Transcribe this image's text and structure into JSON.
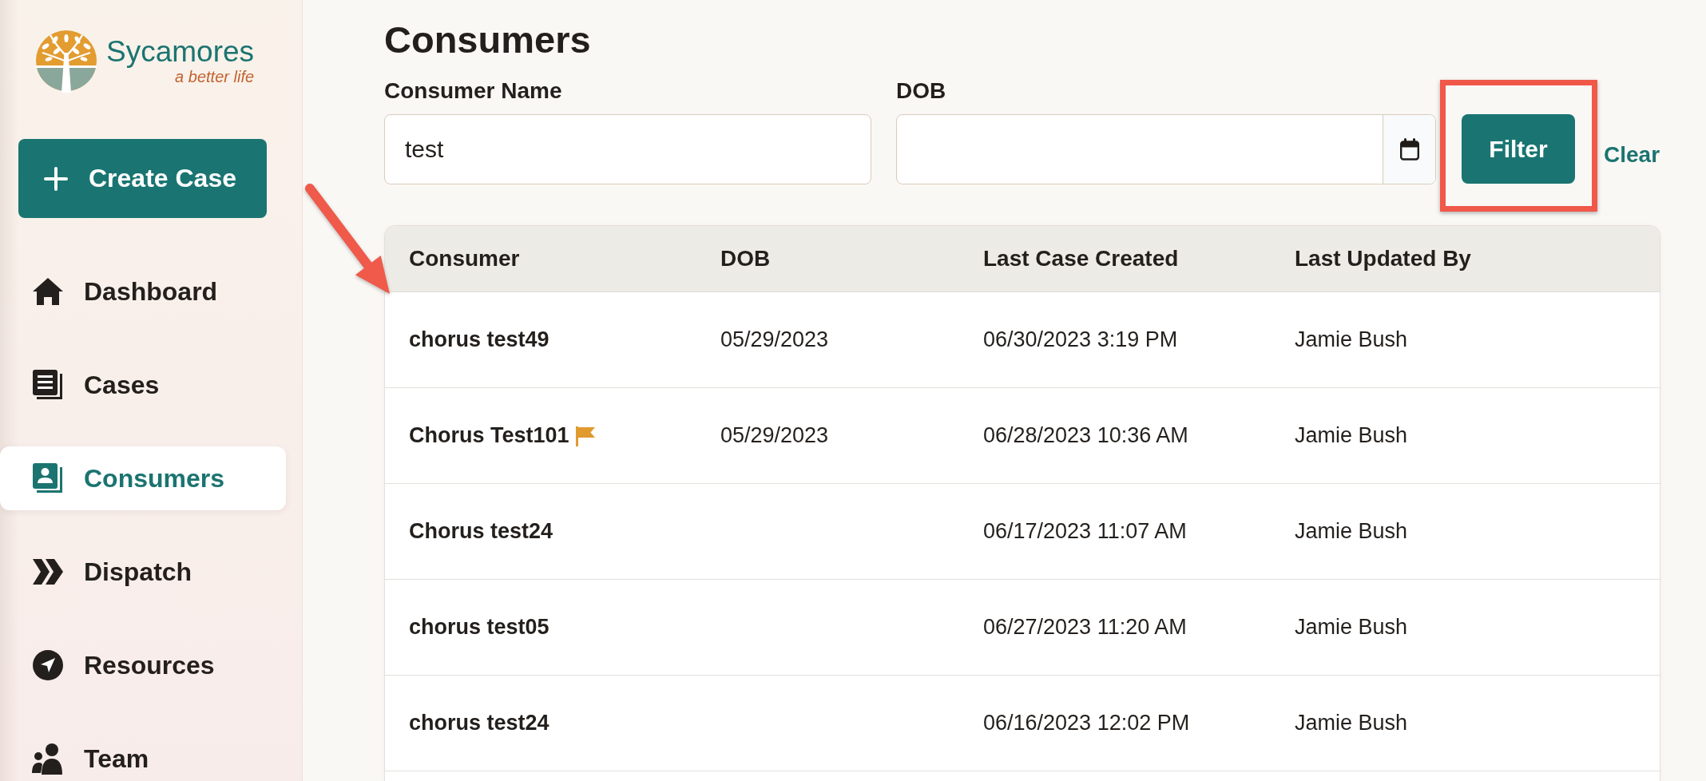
{
  "logo": {
    "name": "Sycamores",
    "tagline": "a better life"
  },
  "create_button": {
    "label": "Create Case"
  },
  "sidebar": {
    "items": [
      {
        "label": "Dashboard",
        "selected": false
      },
      {
        "label": "Cases",
        "selected": false
      },
      {
        "label": "Consumers",
        "selected": true
      },
      {
        "label": "Dispatch",
        "selected": false
      },
      {
        "label": "Resources",
        "selected": false
      },
      {
        "label": "Team",
        "selected": false
      }
    ]
  },
  "page": {
    "title": "Consumers"
  },
  "filters": {
    "fields": [
      {
        "kind": "text",
        "label": "Consumer Name",
        "value": "test"
      },
      {
        "kind": "date",
        "label": "DOB"
      }
    ],
    "filter_button": {
      "label": "Filter"
    },
    "clear_link": {
      "label": "Clear"
    }
  },
  "table": {
    "columns": [
      "Consumer",
      "DOB",
      "Last Case Created",
      "Last Updated By"
    ],
    "rows": [
      {
        "consumer": "chorus test49",
        "flagged": false,
        "dob": "05/29/2023",
        "last_case_created": "06/30/2023 3:19 PM",
        "last_updated_by": "Jamie Bush"
      },
      {
        "consumer": "Chorus Test101",
        "flagged": true,
        "dob": "05/29/2023",
        "last_case_created": "06/28/2023 10:36 AM",
        "last_updated_by": "Jamie Bush"
      },
      {
        "consumer": "Chorus test24",
        "flagged": false,
        "last_case_created": "06/17/2023 11:07 AM",
        "last_updated_by": "Jamie Bush"
      },
      {
        "consumer": "chorus test05",
        "flagged": false,
        "last_case_created": "06/27/2023 11:20 AM",
        "last_updated_by": "Jamie Bush"
      },
      {
        "consumer": "chorus test24",
        "flagged": false,
        "last_case_created": "06/16/2023 12:02 PM",
        "last_updated_by": "Jamie Bush"
      }
    ]
  }
}
